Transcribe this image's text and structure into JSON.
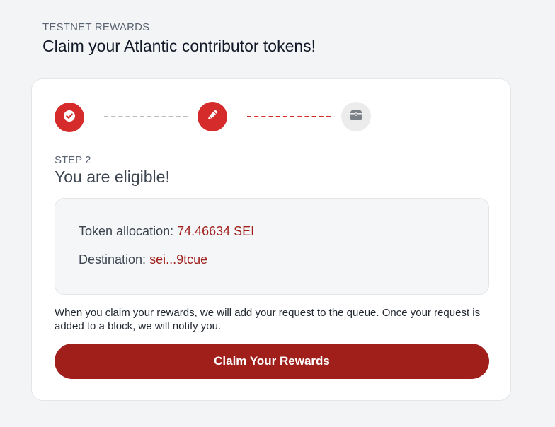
{
  "header": {
    "eyebrow": "TESTNET REWARDS",
    "title": "Claim your Atlantic contributor tokens!"
  },
  "stepper": {
    "steps": [
      {
        "icon": "check-circle-icon",
        "state": "complete"
      },
      {
        "icon": "pencil-icon",
        "state": "active"
      },
      {
        "icon": "treasure-chest-icon",
        "state": "pending"
      }
    ],
    "colors": {
      "active": "#d52b2b",
      "pending": "#ececec",
      "done_connector": "#b9bcc2"
    }
  },
  "step": {
    "label": "STEP 2",
    "title": "You are eligible!"
  },
  "allocation": {
    "token_label": "Token allocation: ",
    "token_value": "74.46634 SEI",
    "destination_label": "Destination: ",
    "destination_value": "sei...9tcue"
  },
  "notice": "When you claim your rewards, we will add your request to the queue. Once your request is added to a block, we will notify you.",
  "claim_button": {
    "label": "Claim Your Rewards",
    "color": "#a11f1b"
  }
}
